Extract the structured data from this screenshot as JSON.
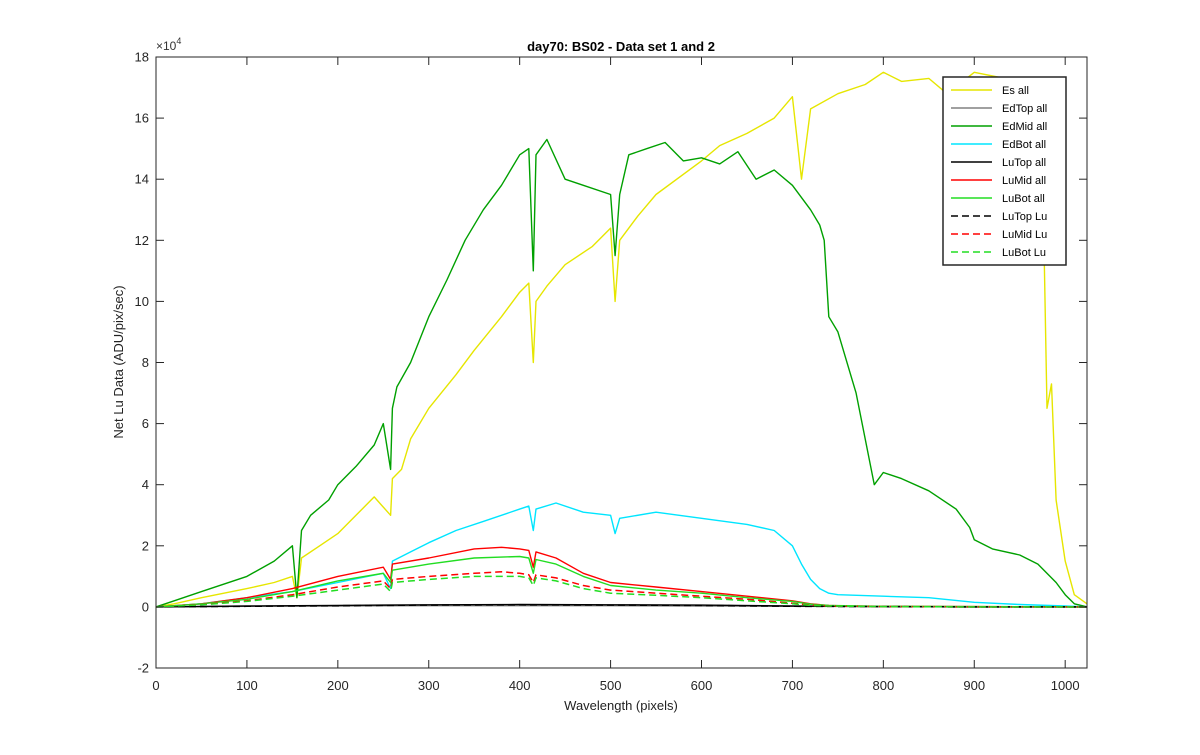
{
  "chart_data": {
    "type": "line",
    "title": "day70: BS02 - Data set 1 and 2",
    "xlabel": "Wavelength (pixels)",
    "ylabel": "Net Lu Data (ADU/pix/sec)",
    "y_exponent_label": "×10",
    "y_exponent_power": "4",
    "xlim": [
      0,
      1024
    ],
    "ylim": [
      -2,
      18
    ],
    "y_scale_note": "values in units of 10^4",
    "xticks": [
      0,
      100,
      200,
      300,
      400,
      500,
      600,
      700,
      800,
      900,
      1000
    ],
    "yticks": [
      -2,
      0,
      2,
      4,
      6,
      8,
      10,
      12,
      14,
      16,
      18
    ],
    "grid": false,
    "legend_position": "top-right",
    "series": [
      {
        "name": "Es  all",
        "color": "#e6e600",
        "dash": "solid",
        "x": [
          0,
          20,
          50,
          100,
          130,
          150,
          155,
          160,
          180,
          200,
          220,
          240,
          258,
          260,
          270,
          280,
          300,
          330,
          350,
          380,
          400,
          410,
          415,
          418,
          430,
          450,
          480,
          500,
          505,
          510,
          530,
          550,
          600,
          620,
          650,
          680,
          700,
          710,
          720,
          750,
          780,
          800,
          820,
          850,
          870,
          900,
          950,
          975,
          980,
          985,
          990,
          1000,
          1010,
          1024
        ],
        "y": [
          0,
          0.1,
          0.3,
          0.6,
          0.8,
          1.0,
          0.3,
          1.6,
          2.0,
          2.4,
          3.0,
          3.6,
          3.0,
          4.2,
          4.5,
          5.5,
          6.5,
          7.6,
          8.4,
          9.5,
          10.3,
          10.6,
          8.0,
          10.0,
          10.5,
          11.2,
          11.8,
          12.4,
          10.0,
          12.0,
          12.8,
          13.5,
          14.6,
          15.1,
          15.5,
          16.0,
          16.7,
          14.0,
          16.3,
          16.8,
          17.1,
          17.5,
          17.2,
          17.3,
          16.8,
          17.5,
          17.2,
          14.5,
          6.5,
          7.3,
          3.5,
          1.5,
          0.4,
          0.1
        ]
      },
      {
        "name": "EdTop  all",
        "color": "#808080",
        "dash": "solid",
        "x": [
          0,
          100,
          200,
          300,
          400,
          500,
          600,
          700,
          800,
          900,
          1024
        ],
        "y": [
          0,
          0.02,
          0.03,
          0.04,
          0.04,
          0.04,
          0.03,
          0.02,
          0.01,
          0.0,
          0.0
        ]
      },
      {
        "name": "EdMid  all",
        "color": "#00a000",
        "dash": "solid",
        "x": [
          0,
          20,
          50,
          100,
          130,
          150,
          155,
          160,
          170,
          190,
          200,
          220,
          240,
          250,
          258,
          260,
          265,
          280,
          300,
          320,
          340,
          360,
          380,
          400,
          410,
          415,
          418,
          430,
          450,
          470,
          500,
          505,
          510,
          520,
          540,
          560,
          580,
          600,
          620,
          640,
          660,
          680,
          700,
          720,
          730,
          735,
          740,
          750,
          770,
          790,
          800,
          820,
          850,
          880,
          895,
          900,
          920,
          950,
          970,
          990,
          1000,
          1010,
          1024
        ],
        "y": [
          0,
          0.2,
          0.5,
          1.0,
          1.5,
          2.0,
          0.3,
          2.5,
          3.0,
          3.5,
          4.0,
          4.6,
          5.3,
          6.0,
          4.5,
          6.5,
          7.2,
          8.0,
          9.5,
          10.7,
          12.0,
          13.0,
          13.8,
          14.8,
          15.0,
          11.0,
          14.8,
          15.3,
          14.0,
          13.8,
          13.5,
          11.5,
          13.5,
          14.8,
          15.0,
          15.2,
          14.6,
          14.7,
          14.5,
          14.9,
          14.0,
          14.3,
          13.8,
          13.0,
          12.5,
          12.0,
          9.5,
          9.0,
          7.0,
          4.0,
          4.4,
          4.2,
          3.8,
          3.2,
          2.6,
          2.2,
          1.9,
          1.7,
          1.4,
          0.8,
          0.4,
          0.1,
          0.0
        ]
      },
      {
        "name": "EdBot  all",
        "color": "#00e5ff",
        "dash": "solid",
        "x": [
          0,
          50,
          100,
          150,
          200,
          250,
          258,
          260,
          280,
          300,
          330,
          360,
          400,
          410,
          415,
          418,
          440,
          470,
          500,
          505,
          510,
          550,
          600,
          650,
          680,
          700,
          710,
          720,
          730,
          740,
          750,
          800,
          850,
          900,
          950,
          1000,
          1024
        ],
        "y": [
          0,
          0.1,
          0.3,
          0.5,
          0.8,
          1.1,
          0.6,
          1.5,
          1.8,
          2.1,
          2.5,
          2.8,
          3.2,
          3.3,
          2.5,
          3.2,
          3.4,
          3.1,
          3.0,
          2.4,
          2.9,
          3.1,
          2.9,
          2.7,
          2.5,
          2.0,
          1.4,
          0.9,
          0.6,
          0.45,
          0.4,
          0.35,
          0.3,
          0.15,
          0.08,
          0.03,
          0.0
        ]
      },
      {
        "name": "LuTop  all",
        "color": "#000000",
        "dash": "solid",
        "x": [
          0,
          100,
          200,
          300,
          400,
          500,
          600,
          700,
          800,
          900,
          1024
        ],
        "y": [
          0,
          0.03,
          0.05,
          0.07,
          0.08,
          0.07,
          0.06,
          0.03,
          0.01,
          0.0,
          0.0
        ]
      },
      {
        "name": "LuMid  all",
        "color": "#ff0000",
        "dash": "solid",
        "x": [
          0,
          50,
          100,
          150,
          200,
          250,
          258,
          260,
          300,
          350,
          380,
          400,
          410,
          415,
          418,
          440,
          470,
          500,
          550,
          600,
          650,
          700,
          720,
          740,
          760,
          800,
          900,
          1024
        ],
        "y": [
          0,
          0.1,
          0.3,
          0.6,
          1.0,
          1.3,
          0.9,
          1.4,
          1.6,
          1.9,
          1.95,
          1.9,
          1.85,
          1.3,
          1.8,
          1.6,
          1.1,
          0.8,
          0.65,
          0.5,
          0.35,
          0.2,
          0.1,
          0.05,
          0.03,
          0.02,
          0.01,
          0.0
        ]
      },
      {
        "name": "LuBot  all",
        "color": "#22dd22",
        "dash": "solid",
        "x": [
          0,
          50,
          100,
          150,
          200,
          250,
          258,
          260,
          300,
          350,
          400,
          410,
          415,
          418,
          440,
          470,
          500,
          550,
          600,
          650,
          700,
          720,
          740,
          800,
          900,
          1024
        ],
        "y": [
          0,
          0.1,
          0.25,
          0.5,
          0.85,
          1.1,
          0.8,
          1.2,
          1.4,
          1.6,
          1.65,
          1.6,
          1.1,
          1.55,
          1.4,
          1.0,
          0.7,
          0.55,
          0.45,
          0.3,
          0.18,
          0.09,
          0.05,
          0.02,
          0.01,
          0.0
        ]
      },
      {
        "name": "LuTop  Lu",
        "color": "#000000",
        "dash": "dashed",
        "x": [
          0,
          100,
          200,
          300,
          400,
          500,
          600,
          700,
          800,
          900,
          1024
        ],
        "y": [
          0,
          0.02,
          0.04,
          0.06,
          0.07,
          0.06,
          0.05,
          0.02,
          0.01,
          0.0,
          0.0
        ]
      },
      {
        "name": "LuMid  Lu",
        "color": "#ff0000",
        "dash": "dashed",
        "x": [
          0,
          50,
          100,
          150,
          200,
          250,
          258,
          260,
          300,
          350,
          380,
          400,
          410,
          415,
          418,
          440,
          470,
          500,
          550,
          600,
          650,
          700,
          720,
          740,
          800,
          900,
          1024
        ],
        "y": [
          0,
          0.08,
          0.2,
          0.4,
          0.65,
          0.85,
          0.6,
          0.9,
          1.0,
          1.1,
          1.15,
          1.1,
          1.05,
          0.8,
          1.05,
          0.95,
          0.7,
          0.55,
          0.45,
          0.35,
          0.25,
          0.12,
          0.06,
          0.03,
          0.01,
          0.0,
          0.0
        ]
      },
      {
        "name": "LuBot  Lu",
        "color": "#22dd22",
        "dash": "dashed",
        "x": [
          0,
          50,
          100,
          150,
          200,
          250,
          258,
          260,
          300,
          350,
          400,
          410,
          415,
          418,
          440,
          470,
          500,
          550,
          600,
          650,
          700,
          720,
          740,
          800,
          900,
          1024
        ],
        "y": [
          0,
          0.07,
          0.18,
          0.35,
          0.55,
          0.75,
          0.5,
          0.8,
          0.9,
          1.0,
          1.0,
          0.95,
          0.7,
          0.95,
          0.85,
          0.6,
          0.45,
          0.38,
          0.3,
          0.2,
          0.1,
          0.05,
          0.03,
          0.01,
          0.0,
          0.0
        ]
      }
    ]
  }
}
